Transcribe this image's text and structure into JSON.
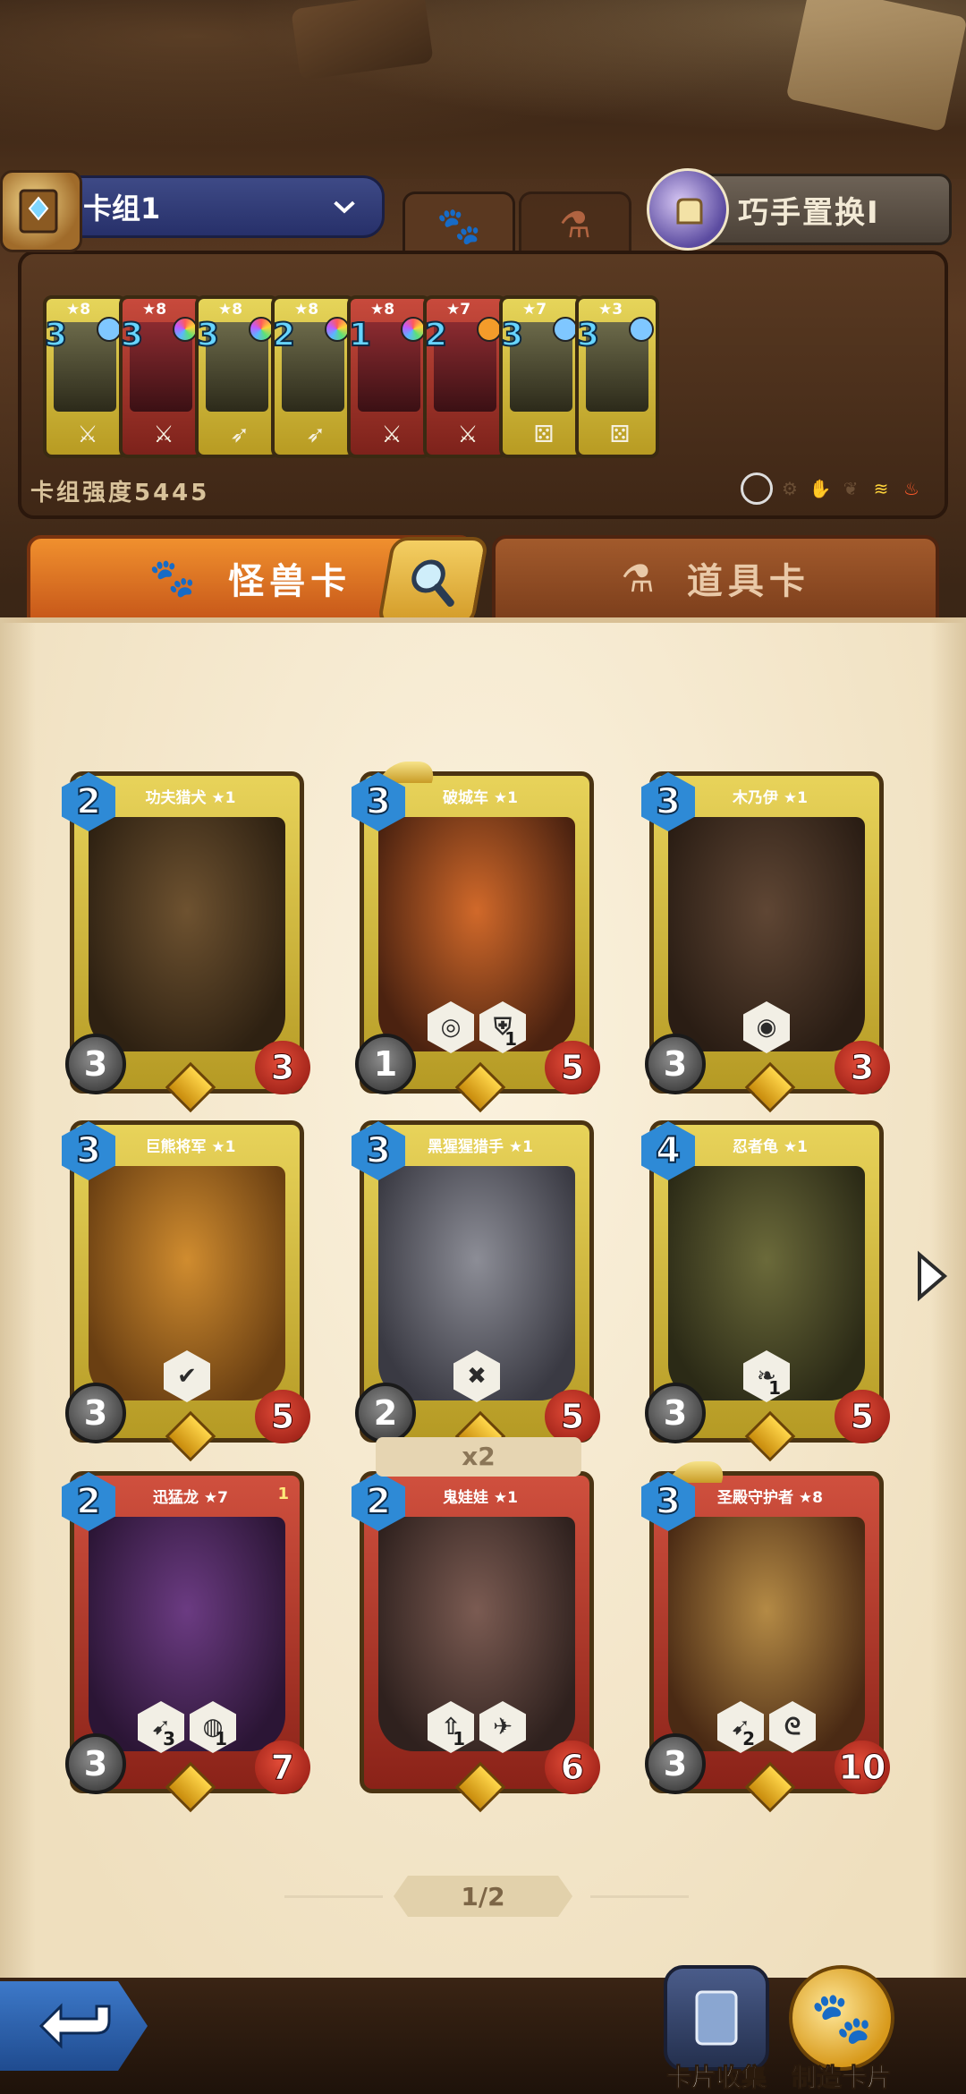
{
  "deck": {
    "name": "卡组1",
    "strength_label": "卡组强度5445",
    "swap_button": "巧手置换I",
    "cards": [
      {
        "cost": "3",
        "stars": "★8",
        "frame": "gold",
        "gem": "#7fc7ff",
        "tool": "sword"
      },
      {
        "cost": "3",
        "stars": "★8",
        "frame": "red",
        "gem": "rainbow",
        "tool": "sword"
      },
      {
        "cost": "3",
        "stars": "★8",
        "frame": "gold",
        "gem": "rainbow",
        "tool": "bow"
      },
      {
        "cost": "2",
        "stars": "★8",
        "frame": "gold",
        "gem": "rainbow",
        "tool": "bow"
      },
      {
        "cost": "1",
        "stars": "★8",
        "frame": "red",
        "gem": "rainbow",
        "tool": "sword"
      },
      {
        "cost": "2",
        "stars": "★7",
        "frame": "red",
        "gem": "#f39c2a",
        "tool": "sword"
      },
      {
        "cost": "3",
        "stars": "★7",
        "frame": "gold",
        "gem": "#7fc7ff",
        "tool": "dice"
      },
      {
        "cost": "3",
        "stars": "★3",
        "frame": "gold",
        "gem": "#7fc7ff",
        "tool": "dice"
      }
    ]
  },
  "tabs": {
    "monster": "怪兽卡",
    "item": "道具卡"
  },
  "cards": [
    {
      "name": "功夫猎犬 ★1",
      "cost": "2",
      "atk": "3",
      "hp": "3",
      "frame": "gold",
      "art": [
        "#6e5230",
        "#2e2112"
      ],
      "abilities": []
    },
    {
      "name": "破城车 ★1",
      "cost": "3",
      "atk": "1",
      "hp": "5",
      "frame": "gold",
      "art": [
        "#d1692a",
        "#4b2210"
      ],
      "abilities": [
        {
          "icon": "whirl",
          "num": ""
        },
        {
          "icon": "shield",
          "num": "1"
        }
      ]
    },
    {
      "name": "木乃伊 ★1",
      "cost": "3",
      "atk": "3",
      "hp": "3",
      "frame": "gold",
      "art": [
        "#5f4634",
        "#2a1d14"
      ],
      "abilities": [
        {
          "icon": "eye",
          "num": ""
        }
      ]
    },
    {
      "name": "巨熊将军 ★1",
      "cost": "3",
      "atk": "3",
      "hp": "5",
      "frame": "gold",
      "art": [
        "#d08c2f",
        "#6a3f12"
      ],
      "abilities": [
        {
          "icon": "check",
          "num": ""
        }
      ]
    },
    {
      "name": "黑猩猩猎手 ★1",
      "cost": "3",
      "atk": "2",
      "hp": "5",
      "frame": "gold",
      "art": [
        "#8c8d96",
        "#3a3a43"
      ],
      "abilities": [
        {
          "icon": "cross",
          "num": ""
        }
      ]
    },
    {
      "name": "忍者龟 ★1",
      "cost": "4",
      "atk": "3",
      "hp": "5",
      "frame": "gold",
      "art": [
        "#6b6a3a",
        "#2b2a16"
      ],
      "abilities": [
        {
          "icon": "leaf",
          "num": "1"
        }
      ]
    },
    {
      "name": "迅猛龙 ★7",
      "cost": "2",
      "atk": "3",
      "hp": "7",
      "frame": "red",
      "badge": "1",
      "art": [
        "#6b3b82",
        "#2b1535"
      ],
      "abilities": [
        {
          "icon": "horn",
          "num": "3"
        },
        {
          "icon": "claw",
          "num": "1"
        }
      ]
    },
    {
      "name": "鬼娃娃 ★1",
      "cost": "2",
      "atk": "",
      "hp": "6",
      "frame": "red",
      "art": [
        "#7b5b52",
        "#2f211e"
      ],
      "abilities": [
        {
          "icon": "up",
          "num": "1"
        },
        {
          "icon": "fly",
          "num": ""
        }
      ]
    },
    {
      "name": "圣殿守护者 ★8",
      "cost": "3",
      "atk": "3",
      "hp": "10",
      "frame": "red",
      "art": [
        "#b48a45",
        "#4a2a14"
      ],
      "abilities": [
        {
          "icon": "horn",
          "num": "2"
        },
        {
          "icon": "swirl",
          "num": ""
        }
      ]
    }
  ],
  "multiplier": "x2",
  "pagination": "1/2",
  "bottom_nav": {
    "collection": "卡片收集",
    "craft": "制造卡片"
  }
}
